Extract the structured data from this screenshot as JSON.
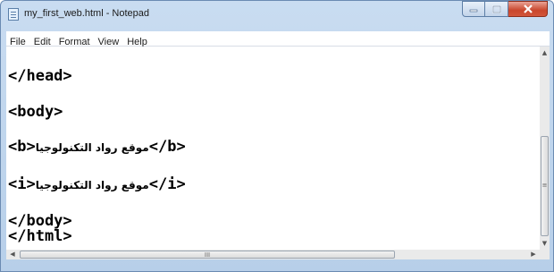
{
  "window": {
    "title": "my_first_web.html - Notepad"
  },
  "menu": [
    "File",
    "Edit",
    "Format",
    "View",
    "Help"
  ],
  "code": {
    "line1": "</head>",
    "line2": "<body>",
    "line3_open": "<b>",
    "line3_text": "موقع رواد التكنولوجيا",
    "line3_close": "</b>",
    "line4_open": "<i>",
    "line4_text": "موقع رواد التكنولوجيا",
    "line4_close": "</i>",
    "line5": "</body>",
    "line6": "</html>"
  },
  "scrollbars": {
    "grip": "≡",
    "hgrip": "III"
  },
  "colors": {
    "close_button": "#c9462c",
    "titlebar": "#c9dcf1"
  }
}
